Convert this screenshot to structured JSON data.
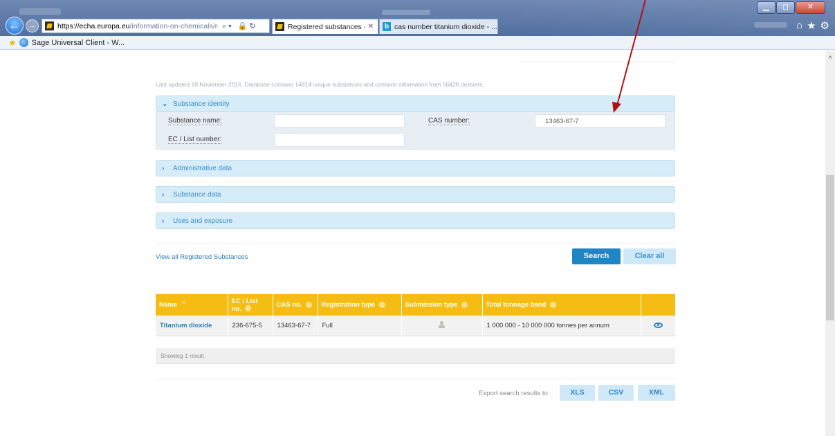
{
  "browser": {
    "address_domain": "https://echa.europa.eu",
    "address_rest": "/information-on-chemicals/registere",
    "tab_active": "Registered substances - EC...",
    "tab_other": "cas number titanium dioxide - ...",
    "favorite": "Sage Universal Client - W..."
  },
  "page": {
    "updated_text": "Last updated 18 November 2016. Database contains 14814 unique substances and contains information from 56428 dossiers.",
    "panels": {
      "identity": "Substance identity",
      "administrative": "Administrative data",
      "substance_data": "Substance data",
      "uses": "Uses and exposure"
    },
    "fields": {
      "substance_name_label": "Substance name:",
      "substance_name_value": "",
      "cas_label": "CAS number:",
      "cas_value": "13463-67-7",
      "ec_label": "EC / List number:",
      "ec_value": ""
    },
    "view_all": "View all Registered Substances",
    "search_label": "Search",
    "clear_label": "Clear all"
  },
  "table": {
    "headers": {
      "name": "Name",
      "ec": "EC / List no.",
      "cas": "CAS no.",
      "reg_type": "Registration type",
      "sub_type": "Submission type",
      "tonnage": "Total tonnage band"
    },
    "rows": [
      {
        "name": "Titanium dioxide",
        "ec": "236-675-5",
        "cas": "13463-67-7",
        "reg_type": "Full",
        "tonnage": "1 000 000 - 10 000 000 tonnes per annum"
      }
    ],
    "showing": "Showing 1 result."
  },
  "export": {
    "label": "Export search results to:",
    "xls": "XLS",
    "csv": "CSV",
    "xml": "XML"
  },
  "colors": {
    "table_header": "#f5bd14",
    "accent_blue": "#1f86c6",
    "annotation_arrow": "#b01010"
  },
  "icons": [
    "back-icon",
    "forward-icon",
    "search-icon",
    "lock-icon",
    "refresh-icon",
    "home-icon",
    "star-icon",
    "gear-icon",
    "sort-icon",
    "person-icon",
    "eye-icon"
  ]
}
